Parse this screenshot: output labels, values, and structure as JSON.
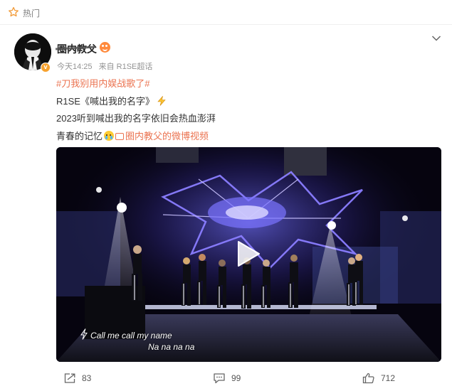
{
  "topbar": {
    "label": "热门"
  },
  "post": {
    "username": "圈内教父",
    "time": "今天14:25",
    "source": "来自 R1SE超话",
    "lines": {
      "hashtag": "#刀我别用内娱战歌了#",
      "song": "R1SE《喊出我的名字》",
      "feeling": "2023听到喊出我的名字依旧会热血澎湃",
      "memory": "青春的记忆",
      "video_link": "圈内教父的微博视频"
    }
  },
  "video": {
    "caption_line1": "Call me call my name",
    "caption_line2": "Na na na na"
  },
  "actions": {
    "repost_count": "83",
    "comment_count": "99",
    "like_count": "712"
  }
}
